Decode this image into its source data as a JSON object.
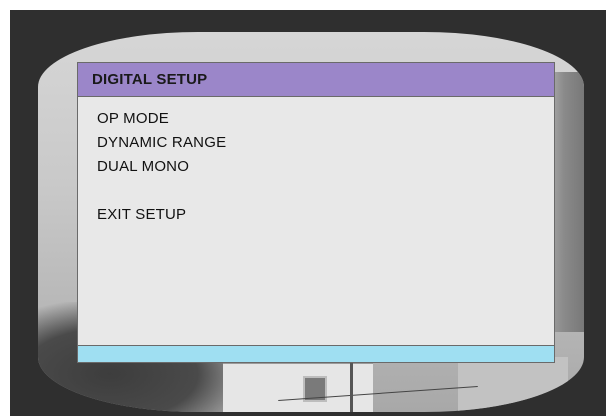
{
  "menu": {
    "title": "DIGITAL SETUP",
    "items": [
      {
        "label": "OP MODE"
      },
      {
        "label": "DYNAMIC RANGE"
      },
      {
        "label": "DUAL MONO"
      }
    ],
    "exit_label": "EXIT SETUP"
  },
  "colors": {
    "title_bar": "#9b86c9",
    "menu_background": "#e8e8e8",
    "status_bar": "#9fdff2",
    "frame": "#2f2f2f"
  }
}
